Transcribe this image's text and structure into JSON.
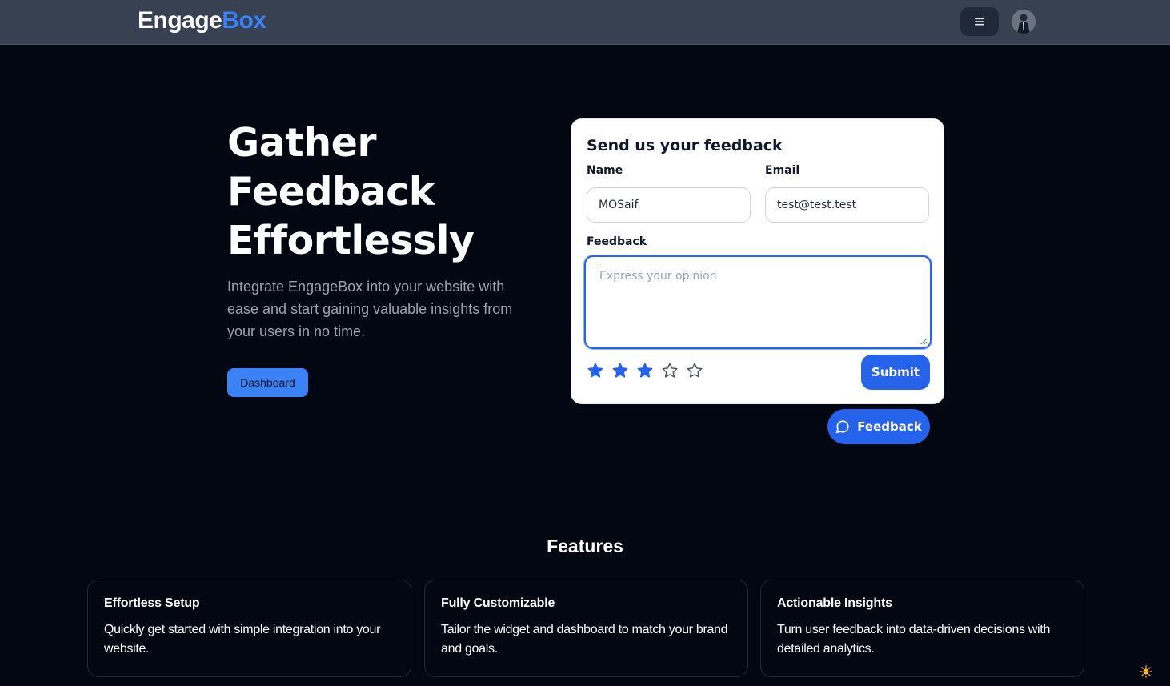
{
  "header": {
    "logo_part1": "Engage",
    "logo_part2": "Box",
    "menu_icon": "hamburger-icon",
    "avatar_icon": "user-avatar"
  },
  "hero": {
    "title_line1": "Gather",
    "title_line2": "Feedback",
    "title_line3": "Effortlessly",
    "subtitle": "Integrate EngageBox into your website with ease and start gaining valuable insights from your users in no time.",
    "dashboard_label": "Dashboard"
  },
  "feedback_form": {
    "title": "Send us your feedback",
    "name_label": "Name",
    "name_value": "MOSaif",
    "email_label": "Email",
    "email_value": "test@test.test",
    "feedback_label": "Feedback",
    "feedback_placeholder": "Express your opinion",
    "rating": 3,
    "rating_max": 5,
    "submit_label": "Submit"
  },
  "feedback_trigger": {
    "label": "Feedback",
    "icon": "chat-bubble-icon"
  },
  "features": {
    "title": "Features",
    "items": [
      {
        "title": "Effortless Setup",
        "text": "Quickly get started with simple integration into your website."
      },
      {
        "title": "Fully Customizable",
        "text": "Tailor the widget and dashboard to match your brand and goals."
      },
      {
        "title": "Actionable Insights",
        "text": "Turn user feedback into data-driven decisions with detailed analytics."
      }
    ]
  },
  "colors": {
    "background": "#030712",
    "topbar": "#374151",
    "accent": "#3b82f6",
    "primary_button": "#2563eb"
  }
}
